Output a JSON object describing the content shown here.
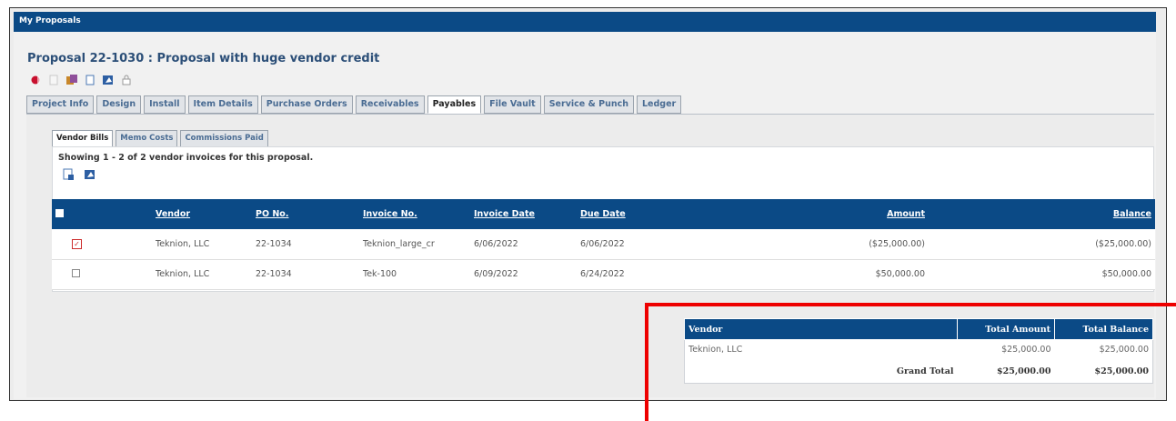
{
  "window": {
    "title": "My Proposals"
  },
  "proposal": {
    "title": "Proposal 22-1030 : Proposal with huge vendor credit"
  },
  "toolbar_icons": [
    "record-icon",
    "blank-doc-icon",
    "tag-icon",
    "document-icon",
    "pdf-icon",
    "lock-icon"
  ],
  "main_tabs": [
    {
      "label": "Project Info"
    },
    {
      "label": "Design"
    },
    {
      "label": "Install"
    },
    {
      "label": "Item Details"
    },
    {
      "label": "Purchase Orders"
    },
    {
      "label": "Receivables"
    },
    {
      "label": "Payables",
      "active": true
    },
    {
      "label": "File Vault"
    },
    {
      "label": "Service & Punch"
    },
    {
      "label": "Ledger"
    }
  ],
  "sub_tabs": [
    {
      "label": "Vendor Bills",
      "active": true
    },
    {
      "label": "Memo Costs"
    },
    {
      "label": "Commissions Paid"
    }
  ],
  "showing_text": "Showing 1 - 2 of 2 vendor invoices for this proposal.",
  "bills_table": {
    "headers": {
      "vendor": "Vendor",
      "po_no": "PO No.",
      "invoice_no": "Invoice No.",
      "invoice_date": "Invoice Date",
      "due_date": "Due Date",
      "amount": "Amount",
      "balance": "Balance"
    },
    "rows": [
      {
        "vendor": "Teknion, LLC",
        "po_no": "22-1034",
        "invoice_no": "Teknion_large_cr",
        "invoice_date": "6/06/2022",
        "due_date": "6/06/2022",
        "amount": "($25,000.00)",
        "balance": "($25,000.00)"
      },
      {
        "vendor": "Teknion, LLC",
        "po_no": "22-1034",
        "invoice_no": "Tek-100",
        "invoice_date": "6/09/2022",
        "due_date": "6/24/2022",
        "amount": "$50,000.00",
        "balance": "$50,000.00"
      }
    ]
  },
  "summary_table": {
    "headers": {
      "vendor": "Vendor",
      "total_amount": "Total Amount",
      "total_balance": "Total Balance"
    },
    "rows": [
      {
        "vendor": "Teknion, LLC",
        "total_amount": "$25,000.00",
        "total_balance": "$25,000.00"
      }
    ],
    "grand": {
      "label": "Grand Total",
      "total_amount": "$25,000.00",
      "total_balance": "$25,000.00"
    }
  },
  "colors": {
    "header_blue": "#0b4a86",
    "annotation_red": "#ee0000"
  }
}
